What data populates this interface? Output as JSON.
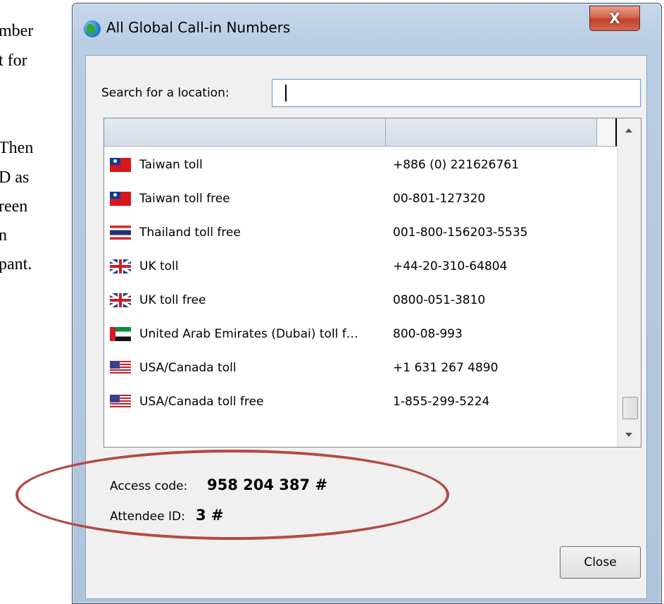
{
  "background_document": {
    "lines": [
      "mber",
      "t for",
      "Then",
      "D as",
      "reen",
      "n",
      "pant."
    ]
  },
  "window": {
    "title": "All Global Call-in Numbers",
    "close_glyph": "X",
    "accent_color": "#5b9bd5"
  },
  "search": {
    "label": "Search for a location:",
    "value": ""
  },
  "list": {
    "rows": [
      {
        "flag": "taiwan-flag-icon",
        "name": "Taiwan toll",
        "number": "+886 (0) 221626761"
      },
      {
        "flag": "taiwan-flag-icon",
        "name": "Taiwan toll free",
        "number": "00-801-127320"
      },
      {
        "flag": "thailand-flag-icon",
        "name": "Thailand toll free",
        "number": "001-800-156203-5535"
      },
      {
        "flag": "uk-flag-icon",
        "name": "UK toll",
        "number": "+44-20-310-64804"
      },
      {
        "flag": "uk-flag-icon",
        "name": "UK toll free",
        "number": "0800-051-3810"
      },
      {
        "flag": "uae-flag-icon",
        "name": "United Arab Emirates (Dubai) toll f…",
        "number": "800-08-993"
      },
      {
        "flag": "usa-flag-icon",
        "name": "USA/Canada toll",
        "number": "+1 631 267 4890"
      },
      {
        "flag": "usa-flag-icon",
        "name": "USA/Canada toll free",
        "number": "1-855-299-5224"
      }
    ]
  },
  "access": {
    "code_label": "Access code:",
    "code_value": "958 204 387 #",
    "attendee_label": "Attendee ID:",
    "attendee_value": "3 #"
  },
  "buttons": {
    "close_label": "Close"
  },
  "annotation": {
    "color": "#b24a45"
  }
}
